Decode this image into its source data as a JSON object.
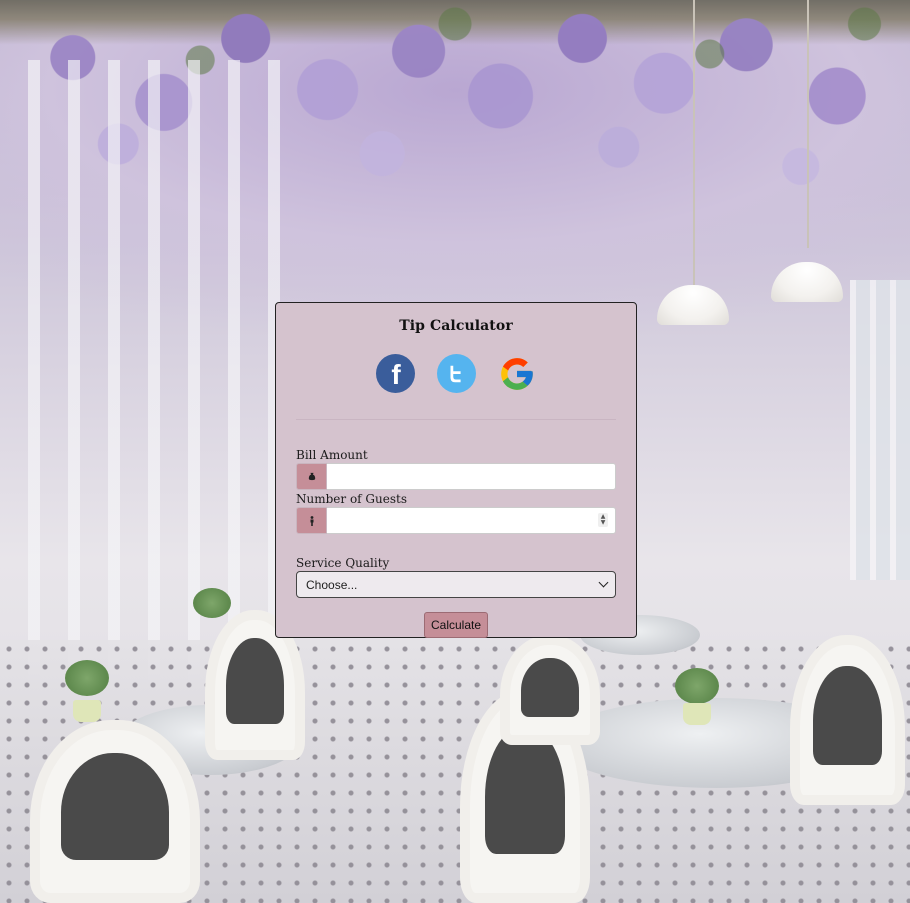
{
  "card": {
    "title": "Tip Calculator"
  },
  "social": [
    {
      "name": "facebook",
      "glyph": "f",
      "color": "#3a5d9b"
    },
    {
      "name": "twitter",
      "color": "#55b4ef"
    },
    {
      "name": "google",
      "colors": [
        "#4285F4",
        "#EA4335",
        "#FBBC05",
        "#34A853"
      ]
    }
  ],
  "form": {
    "bill": {
      "label": "Bill Amount",
      "value": "",
      "placeholder": "",
      "icon": "money-bag-icon"
    },
    "guests": {
      "label": "Number of Guests",
      "value": "",
      "placeholder": "",
      "icon": "person-icon"
    },
    "quality": {
      "label": "Service Quality",
      "selected": "Choose..."
    },
    "calculate_label": "Calculate"
  },
  "colors": {
    "card_bg": "#d5c3ce",
    "accent": "#c58e98"
  }
}
